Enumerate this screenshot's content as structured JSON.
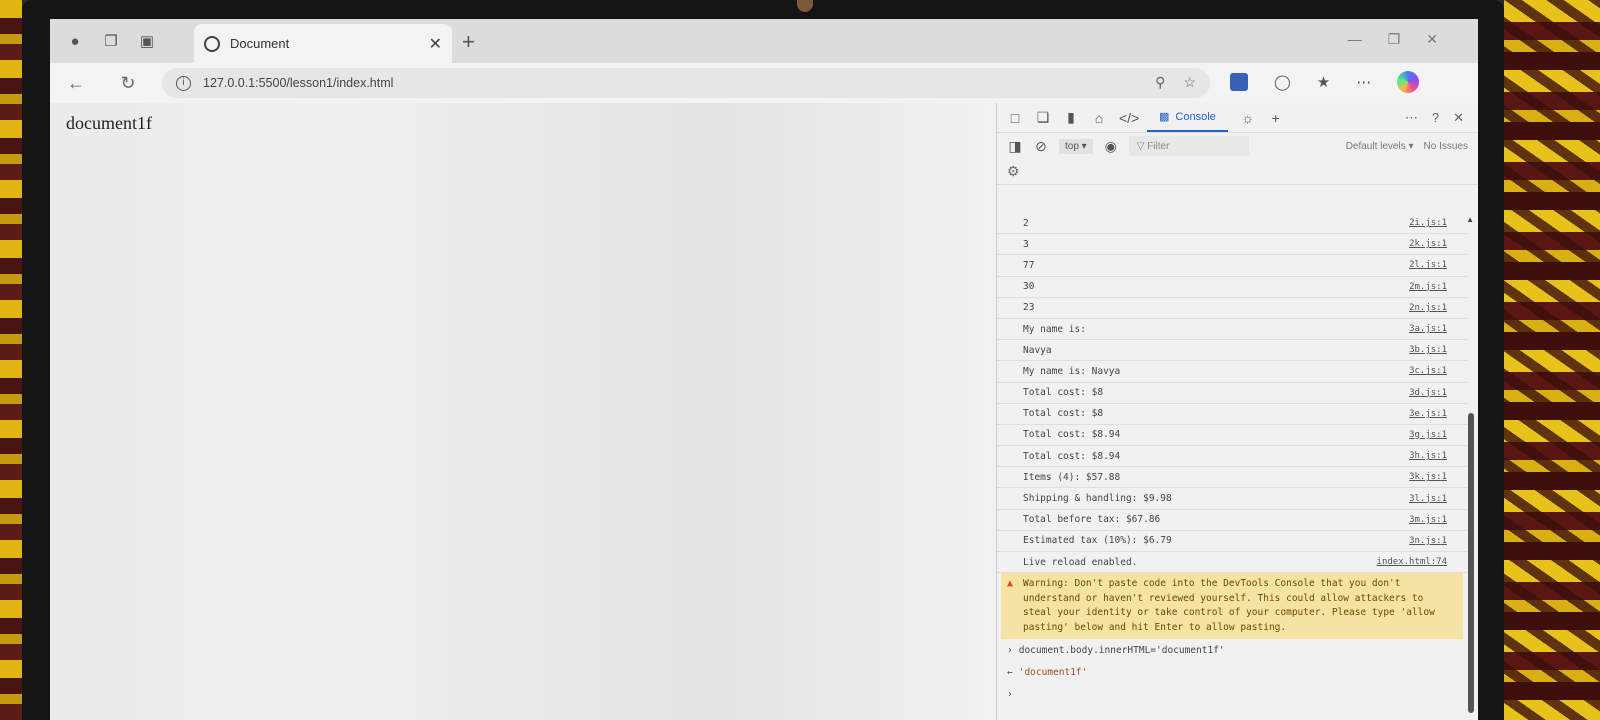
{
  "browser": {
    "tab_title": "Document",
    "url": "127.0.0.1:5500/lesson1/index.html"
  },
  "page": {
    "body_text": "document1f"
  },
  "devtools": {
    "active_tab": "Console",
    "context": "top",
    "filter_placeholder": "Filter",
    "levels": "Default levels",
    "issues": "No Issues",
    "logs": [
      {
        "text": "2",
        "source": "2i.js:1"
      },
      {
        "text": "3",
        "source": "2k.js:1"
      },
      {
        "text": "77",
        "source": "2l.js:1"
      },
      {
        "text": "30",
        "source": "2m.js:1"
      },
      {
        "text": "23",
        "source": "2n.js:1"
      },
      {
        "text": "My name is:",
        "source": "3a.js:1"
      },
      {
        "text": "Navya",
        "source": "3b.js:1"
      },
      {
        "text": "My name is: Navya",
        "source": "3c.js:1"
      },
      {
        "text": "Total cost: $8",
        "source": "3d.js:1"
      },
      {
        "text": "Total cost: $8",
        "source": "3e.js:1"
      },
      {
        "text": "Total cost: $8.94",
        "source": "3g.js:1"
      },
      {
        "text": "Total cost: $8.94",
        "source": "3h.js:1"
      },
      {
        "text": "Items (4): $57.88",
        "source": "3k.js:1"
      },
      {
        "text": "Shipping & handling: $9.98",
        "source": "3l.js:1"
      },
      {
        "text": "Total before tax: $67.86",
        "source": "3m.js:1"
      },
      {
        "text": "Estimated tax (10%): $6.79",
        "source": "3n.js:1"
      },
      {
        "text": "Live reload enabled.",
        "source": "index.html:74"
      }
    ],
    "warning": "Warning: Don't paste code into the DevTools Console that you don't understand or haven't reviewed yourself. This could allow attackers to steal your identity or take control of your computer. Please type 'allow pasting' below and hit Enter to allow pasting.",
    "command": "document.body.innerHTML='document1f'",
    "result": "'document1f'"
  }
}
